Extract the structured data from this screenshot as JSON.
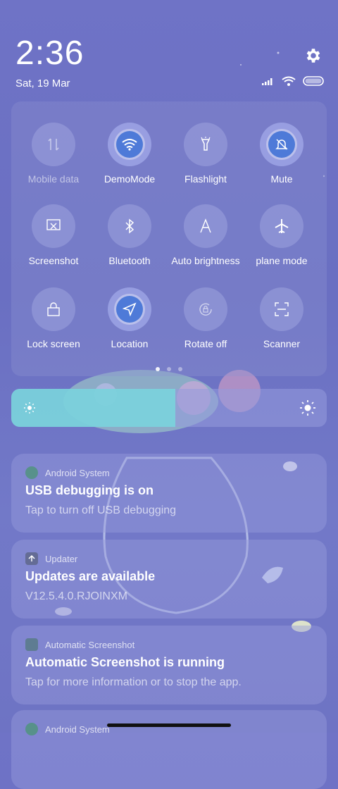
{
  "status": {
    "time": "2:36",
    "date": "Sat, 19 Mar"
  },
  "quick_tiles": [
    {
      "label": "Mobile data",
      "icon": "mobile-data-icon",
      "active": false
    },
    {
      "label": "DemoMode",
      "icon": "wifi-icon",
      "active": true
    },
    {
      "label": "Flashlight",
      "icon": "flashlight-icon",
      "active": false
    },
    {
      "label": "Mute",
      "icon": "mute-icon",
      "active": true
    },
    {
      "label": "Screenshot",
      "icon": "screenshot-icon",
      "active": false
    },
    {
      "label": "Bluetooth",
      "icon": "bluetooth-icon",
      "active": false
    },
    {
      "label": "Auto brightness",
      "icon": "auto-brightness-icon",
      "active": false
    },
    {
      "label": "plane mode",
      "icon": "airplane-icon",
      "active": false
    },
    {
      "label": "Lock screen",
      "icon": "lock-icon",
      "active": false
    },
    {
      "label": "Location",
      "icon": "location-icon",
      "active": true
    },
    {
      "label": "Rotate off",
      "icon": "rotate-lock-icon",
      "active": false
    },
    {
      "label": "Scanner",
      "icon": "scanner-icon",
      "active": false
    }
  ],
  "brightness": {
    "level": 0.52
  },
  "notifications": [
    {
      "app": "Android System",
      "title": "USB debugging is on",
      "text": "Tap to turn off USB debugging"
    },
    {
      "app": "Updater",
      "title": "Updates are available",
      "text": "V12.5.4.0.RJOINXM"
    },
    {
      "app": "Automatic Screenshot",
      "title": "Automatic Screenshot is running",
      "text": "Tap for more information or to stop the app."
    },
    {
      "app": "Android System",
      "title": "",
      "text": ""
    }
  ],
  "colors": {
    "accent": "#4e7ad8",
    "brightness_fill": "#78d7dc"
  }
}
